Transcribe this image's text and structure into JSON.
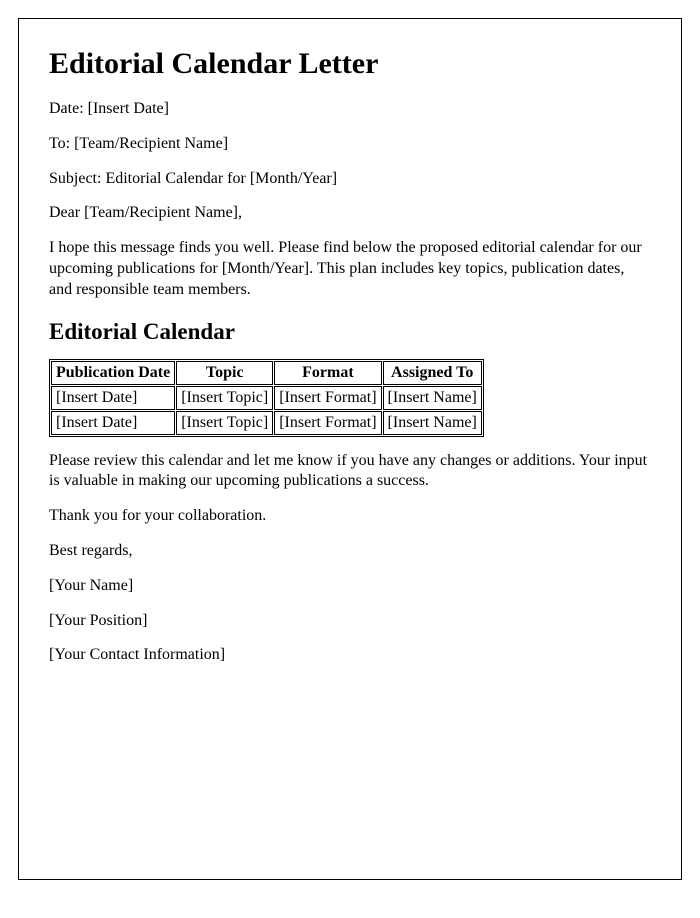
{
  "title": "Editorial Calendar Letter",
  "date_line": "Date: [Insert Date]",
  "to_line": "To: [Team/Recipient Name]",
  "subject_line": "Subject: Editorial Calendar for [Month/Year]",
  "salutation": "Dear [Team/Recipient Name],",
  "intro_paragraph": "I hope this message finds you well. Please find below the proposed editorial calendar for our upcoming publications for [Month/Year]. This plan includes key topics, publication dates, and responsible team members.",
  "calendar_heading": "Editorial Calendar",
  "table": {
    "headers": [
      "Publication Date",
      "Topic",
      "Format",
      "Assigned To"
    ],
    "rows": [
      [
        "[Insert Date]",
        "[Insert Topic]",
        "[Insert Format]",
        "[Insert Name]"
      ],
      [
        "[Insert Date]",
        "[Insert Topic]",
        "[Insert Format]",
        "[Insert Name]"
      ]
    ]
  },
  "review_paragraph": "Please review this calendar and let me know if you have any changes or additions. Your input is valuable in making our upcoming publications a success.",
  "thanks": "Thank you for your collaboration.",
  "closing": "Best regards,",
  "sender_name": "[Your Name]",
  "sender_position": "[Your Position]",
  "sender_contact": "[Your Contact Information]"
}
